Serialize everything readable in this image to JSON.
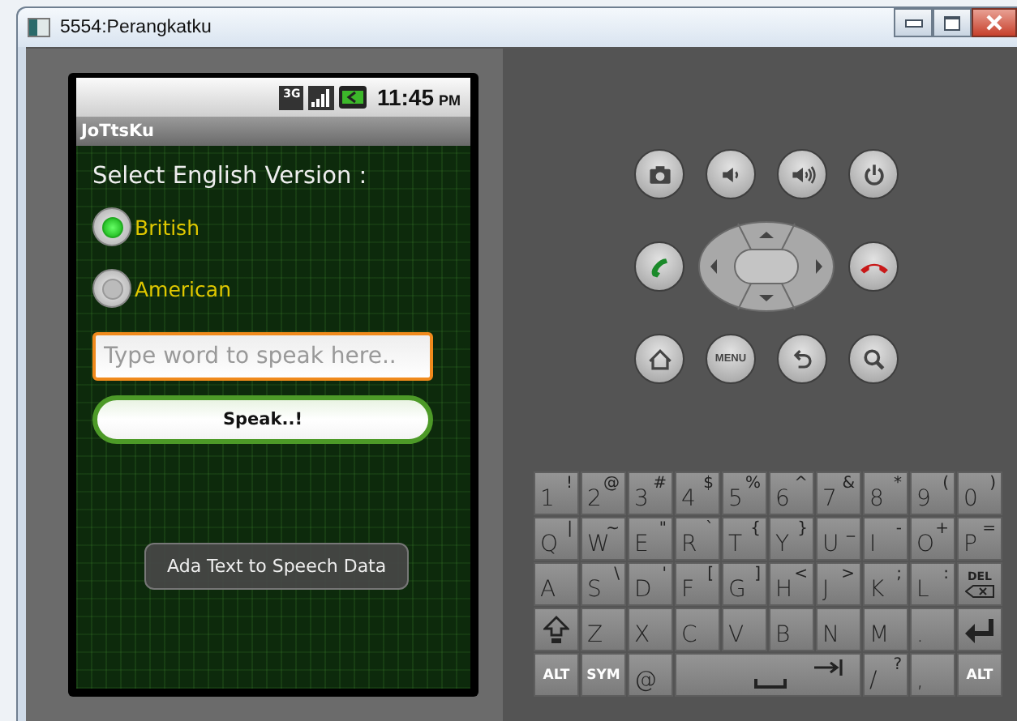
{
  "window": {
    "title": "5554:Perangkatku"
  },
  "status_bar": {
    "network": "3G",
    "time": "11:45",
    "meridiem": "PM"
  },
  "app": {
    "title": "JoTtsKu",
    "prompt": "Select English Version :",
    "options": [
      {
        "label": "British",
        "selected": true
      },
      {
        "label": "American",
        "selected": false
      }
    ],
    "input": {
      "placeholder": "Type word to speak here..",
      "focused": true
    },
    "button": "Speak..!",
    "toast": "Ada Text to Speech Data"
  },
  "controls": [
    [
      {
        "kind": "camera"
      },
      {
        "kind": "volume-down"
      },
      {
        "kind": "volume-up"
      },
      {
        "kind": "power"
      }
    ],
    [
      {
        "kind": "call"
      },
      {
        "kind": "dpad"
      },
      {
        "kind": "end-call"
      }
    ],
    [
      {
        "kind": "home"
      },
      {
        "kind": "text",
        "label": "MENU"
      },
      {
        "kind": "back"
      },
      {
        "kind": "search"
      }
    ]
  ],
  "keyboard": [
    [
      {
        "kind": "char",
        "main": "1",
        "alt": "!"
      },
      {
        "kind": "char",
        "main": "2",
        "alt": "@"
      },
      {
        "kind": "char",
        "main": "3",
        "alt": "#"
      },
      {
        "kind": "char",
        "main": "4",
        "alt": "$"
      },
      {
        "kind": "char",
        "main": "5",
        "alt": "%"
      },
      {
        "kind": "char",
        "main": "6",
        "alt": "^"
      },
      {
        "kind": "char",
        "main": "7",
        "alt": "&"
      },
      {
        "kind": "char",
        "main": "8",
        "alt": "*"
      },
      {
        "kind": "char",
        "main": "9",
        "alt": "("
      },
      {
        "kind": "char",
        "main": "0",
        "alt": ")"
      }
    ],
    [
      {
        "kind": "char",
        "main": "Q",
        "alt": "|"
      },
      {
        "kind": "char",
        "main": "W",
        "alt": "~"
      },
      {
        "kind": "char",
        "main": "E",
        "alt": "\""
      },
      {
        "kind": "char",
        "main": "R",
        "alt": "`"
      },
      {
        "kind": "char",
        "main": "T",
        "alt": "{"
      },
      {
        "kind": "char",
        "main": "Y",
        "alt": "}"
      },
      {
        "kind": "char",
        "main": "U",
        "alt": "_"
      },
      {
        "kind": "char",
        "main": "I",
        "alt": "-"
      },
      {
        "kind": "char",
        "main": "O",
        "alt": "+"
      },
      {
        "kind": "char",
        "main": "P",
        "alt": "="
      }
    ],
    [
      {
        "kind": "char",
        "main": "A"
      },
      {
        "kind": "char",
        "main": "S",
        "alt": "\\"
      },
      {
        "kind": "char",
        "main": "D",
        "alt": "'"
      },
      {
        "kind": "char",
        "main": "F",
        "alt": "["
      },
      {
        "kind": "char",
        "main": "G",
        "alt": "]"
      },
      {
        "kind": "char",
        "main": "H",
        "alt": "<"
      },
      {
        "kind": "char",
        "main": "J",
        "alt": ">"
      },
      {
        "kind": "char",
        "main": "K",
        "alt": ";"
      },
      {
        "kind": "char",
        "main": "L",
        "alt": ":"
      },
      {
        "kind": "del",
        "main": "DEL"
      }
    ],
    [
      {
        "kind": "shift"
      },
      {
        "kind": "char",
        "main": "Z"
      },
      {
        "kind": "char",
        "main": "X"
      },
      {
        "kind": "char",
        "main": "C"
      },
      {
        "kind": "char",
        "main": "V"
      },
      {
        "kind": "char",
        "main": "B"
      },
      {
        "kind": "char",
        "main": "N"
      },
      {
        "kind": "char",
        "main": "M"
      },
      {
        "kind": "char",
        "main": "."
      },
      {
        "kind": "enter"
      }
    ],
    [
      {
        "kind": "mod",
        "main": "ALT"
      },
      {
        "kind": "mod",
        "main": "SYM"
      },
      {
        "kind": "char",
        "main": "@"
      },
      {
        "kind": "space"
      },
      {
        "kind": "char",
        "main": "/",
        "alt": "?"
      },
      {
        "kind": "char",
        "main": ","
      },
      {
        "kind": "mod",
        "main": "ALT"
      }
    ]
  ]
}
